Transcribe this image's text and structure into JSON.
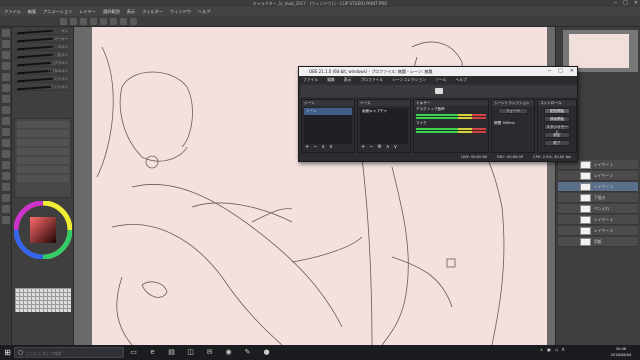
{
  "app": {
    "title": "キャラクター_1(_mod_2017 - [ウィンドウ] ) - CLIP STUDIO PAINT PRO",
    "menu": [
      "ファイル",
      "編集",
      "アニメーション",
      "レイヤー",
      "選択範囲",
      "表示",
      "フィルター",
      "ウィンドウ",
      "ヘルプ"
    ],
    "window_controls": [
      "─",
      "□",
      "✕"
    ]
  },
  "subtool": {
    "brushes": [
      "ペン",
      "マーカー",
      "Gペン",
      "丸ペン",
      "カブラペン",
      "リアルGペン",
      "ミリペン",
      "サインペン"
    ]
  },
  "obs": {
    "title": "OBS 21.1.0 (64-bit, windows) - プロファイル: 無題 - シーン: 無題",
    "window_controls": [
      "─",
      "□",
      "✕"
    ],
    "menu": [
      "ファイル",
      "編集",
      "表示",
      "プロファイル",
      "シーンコレクション",
      "ツール",
      "ヘルプ"
    ],
    "docks": {
      "scenes": {
        "title": "シーン",
        "items": [
          "シーン"
        ]
      },
      "sources": {
        "title": "ソース",
        "items": [
          "画面キャプチャ"
        ]
      },
      "mixer": {
        "title": "ミキサー",
        "items": [
          "デスクトップ音声",
          "マイク"
        ]
      },
      "transitions": {
        "title": "シーントランジション",
        "items": [
          "フェード"
        ],
        "duration_label": "期間",
        "duration_value": "300ms"
      },
      "controls": {
        "title": "コントロール",
        "buttons": [
          "配信開始",
          "録画開始",
          "スタジオモード",
          "設定",
          "終了"
        ]
      }
    },
    "status": {
      "live": "LIVE: 00:00:00",
      "rec": "REC: 00:00:00",
      "cpu": "CPU: 2.5%, 30.00 fps"
    }
  },
  "layers": [
    "レイヤー 1",
    "レイヤー 2",
    "レイヤー 3",
    "下描き",
    "ペン入れ",
    "レイヤー 4",
    "レイヤー 5",
    "用紙"
  ],
  "taskbar": {
    "search_placeholder": "ここに入力して検索",
    "clock_time": "20:46",
    "clock_date": "2018/06/04"
  },
  "colors": {
    "canvas_bg": "#f4e1df",
    "ui_dark": "#3e3e3e",
    "obs_bg": "#2e2f33"
  }
}
